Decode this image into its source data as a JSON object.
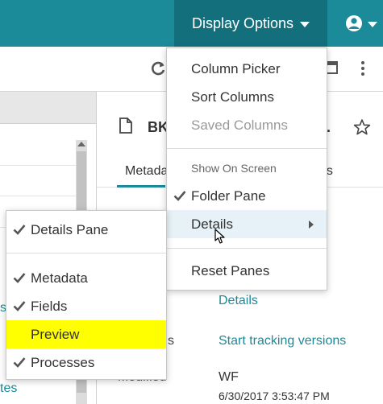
{
  "header": {
    "display_options_label": "Display Options"
  },
  "document": {
    "title": "BK",
    "title_ellipsis": "..",
    "tabs": [
      "Metada",
      "ses"
    ]
  },
  "left_pane": {
    "partial_link_1": "s",
    "partial_link_2": "tes"
  },
  "properties": {
    "details_link": "Details",
    "versions_label_partial": "s",
    "versions_link": "Start tracking versions",
    "modified_label": "Modified",
    "modified_by": "WF",
    "modified_date": "6/30/2017 3:53:47 PM"
  },
  "display_menu": {
    "items": [
      {
        "label": "Column Picker"
      },
      {
        "label": "Sort Columns"
      },
      {
        "label": "Saved Columns",
        "disabled": true
      }
    ],
    "section_label": "Show On Screen",
    "screen_items": [
      {
        "label": "Folder Pane",
        "checked": true
      },
      {
        "label": "Details",
        "submenu": true,
        "highlighted": true
      }
    ],
    "reset_label": "Reset Panes"
  },
  "details_submenu": {
    "pane_item": {
      "label": "Details Pane",
      "checked": true
    },
    "items": [
      {
        "label": "Metadata",
        "checked": true
      },
      {
        "label": "Fields",
        "checked": true
      },
      {
        "label": "Preview",
        "checked": false,
        "highlight_color": "#ffff00"
      },
      {
        "label": "Processes",
        "checked": true
      }
    ]
  },
  "colors": {
    "header_bg": "#1b8a99",
    "header_active_bg": "#146f7c",
    "link": "#1b8a99",
    "menu_hover": "#e6f2f7"
  },
  "icons": [
    "caret-down-icon",
    "user-icon",
    "refresh-icon",
    "maximize-icon",
    "more-vertical-icon",
    "document-icon",
    "star-icon",
    "check-icon",
    "chevron-right-icon",
    "mouse-cursor-icon"
  ]
}
